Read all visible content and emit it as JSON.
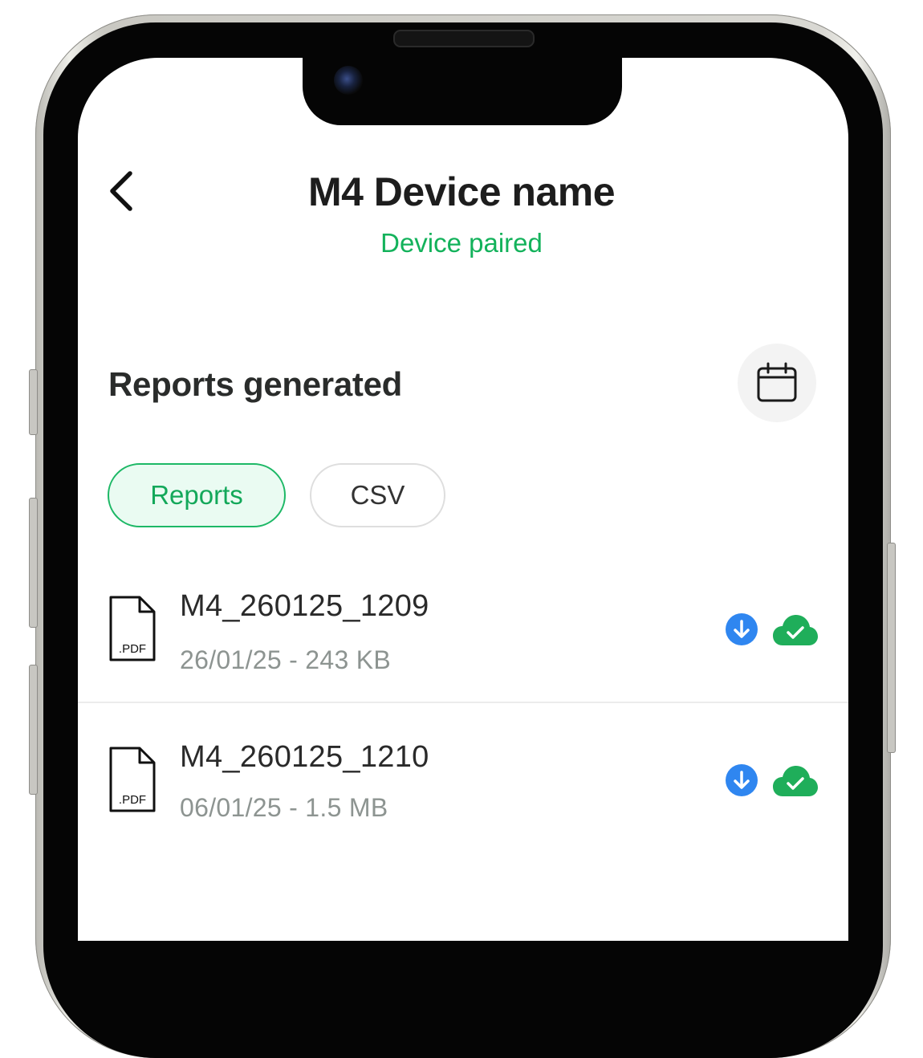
{
  "header": {
    "title": "M4 Device name",
    "status": "Device paired"
  },
  "reports": {
    "section_title": "Reports generated",
    "tabs": [
      {
        "label": "Reports",
        "active": true
      },
      {
        "label": "CSV",
        "active": false
      }
    ],
    "files": [
      {
        "name": "M4_260125_1209",
        "meta": "26/01/25 - 243 KB",
        "icon_label": ".PDF"
      },
      {
        "name": "M4_260125_1210",
        "meta": "06/01/25 - 1.5 MB",
        "icon_label": ".PDF"
      }
    ]
  },
  "icons": {
    "back": "chevron-left-icon",
    "calendar": "calendar-icon",
    "file": "pdf-file-icon",
    "download": "download-icon",
    "cloud": "cloud-check-icon"
  },
  "colors": {
    "accent_green": "#13b25b",
    "download_blue": "#2f86f0",
    "cloud_green": "#1fae5a"
  }
}
